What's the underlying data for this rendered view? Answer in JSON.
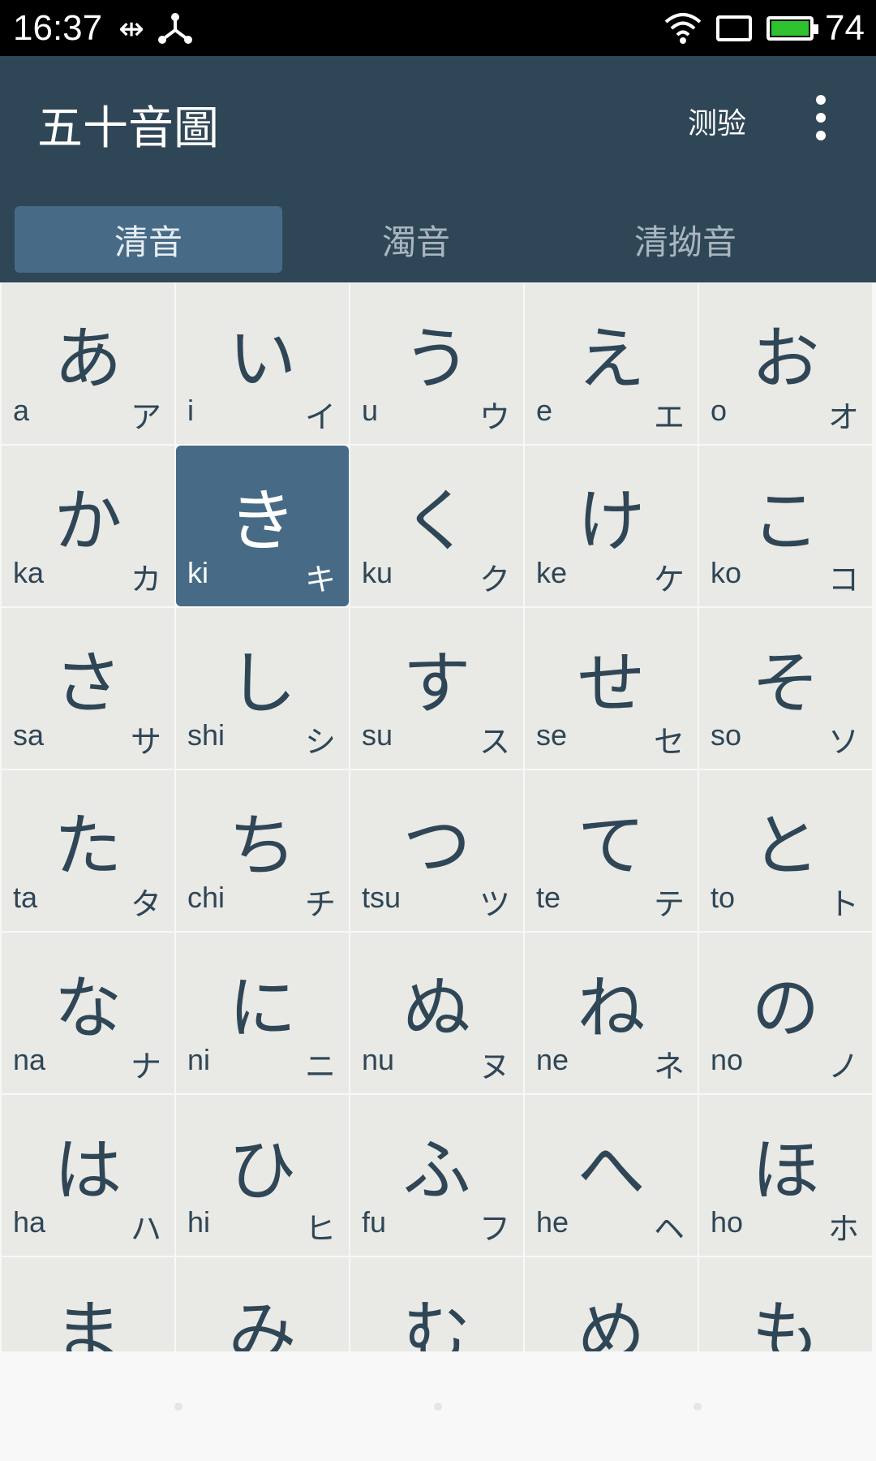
{
  "status_bar": {
    "time": "16:37",
    "battery_level": "74",
    "icons": [
      "usb-icon",
      "usb-network-icon",
      "wifi-icon",
      "rotation-icon",
      "battery-icon"
    ]
  },
  "app_bar": {
    "title": "五十音圖",
    "quiz_label": "测验",
    "more_icon": "more-vert-icon"
  },
  "tabs": [
    {
      "label": "清音",
      "active": true
    },
    {
      "label": "濁音",
      "active": false
    },
    {
      "label": "清拗音",
      "active": false
    }
  ],
  "grid": {
    "selected": "ki",
    "cells": [
      {
        "kana": "あ",
        "romaji": "a",
        "katakana": "ア"
      },
      {
        "kana": "い",
        "romaji": "i",
        "katakana": "イ"
      },
      {
        "kana": "う",
        "romaji": "u",
        "katakana": "ウ"
      },
      {
        "kana": "え",
        "romaji": "e",
        "katakana": "エ"
      },
      {
        "kana": "お",
        "romaji": "o",
        "katakana": "オ"
      },
      {
        "kana": "か",
        "romaji": "ka",
        "katakana": "カ"
      },
      {
        "kana": "き",
        "romaji": "ki",
        "katakana": "キ"
      },
      {
        "kana": "く",
        "romaji": "ku",
        "katakana": "ク"
      },
      {
        "kana": "け",
        "romaji": "ke",
        "katakana": "ケ"
      },
      {
        "kana": "こ",
        "romaji": "ko",
        "katakana": "コ"
      },
      {
        "kana": "さ",
        "romaji": "sa",
        "katakana": "サ"
      },
      {
        "kana": "し",
        "romaji": "shi",
        "katakana": "シ"
      },
      {
        "kana": "す",
        "romaji": "su",
        "katakana": "ス"
      },
      {
        "kana": "せ",
        "romaji": "se",
        "katakana": "セ"
      },
      {
        "kana": "そ",
        "romaji": "so",
        "katakana": "ソ"
      },
      {
        "kana": "た",
        "romaji": "ta",
        "katakana": "タ"
      },
      {
        "kana": "ち",
        "romaji": "chi",
        "katakana": "チ"
      },
      {
        "kana": "つ",
        "romaji": "tsu",
        "katakana": "ツ"
      },
      {
        "kana": "て",
        "romaji": "te",
        "katakana": "テ"
      },
      {
        "kana": "と",
        "romaji": "to",
        "katakana": "ト"
      },
      {
        "kana": "な",
        "romaji": "na",
        "katakana": "ナ"
      },
      {
        "kana": "に",
        "romaji": "ni",
        "katakana": "ニ"
      },
      {
        "kana": "ぬ",
        "romaji": "nu",
        "katakana": "ヌ"
      },
      {
        "kana": "ね",
        "romaji": "ne",
        "katakana": "ネ"
      },
      {
        "kana": "の",
        "romaji": "no",
        "katakana": "ノ"
      },
      {
        "kana": "は",
        "romaji": "ha",
        "katakana": "ハ"
      },
      {
        "kana": "ひ",
        "romaji": "hi",
        "katakana": "ヒ"
      },
      {
        "kana": "ふ",
        "romaji": "fu",
        "katakana": "フ"
      },
      {
        "kana": "へ",
        "romaji": "he",
        "katakana": "ヘ"
      },
      {
        "kana": "ほ",
        "romaji": "ho",
        "katakana": "ホ"
      },
      {
        "kana": "ま",
        "romaji": "",
        "katakana": ""
      },
      {
        "kana": "み",
        "romaji": "",
        "katakana": ""
      },
      {
        "kana": "む",
        "romaji": "",
        "katakana": ""
      },
      {
        "kana": "め",
        "romaji": "",
        "katakana": ""
      },
      {
        "kana": "も",
        "romaji": "",
        "katakana": ""
      }
    ]
  },
  "colors": {
    "app_bar": "#2f4656",
    "accent": "#476b86",
    "cell_bg": "#e9e9e5",
    "kana_text": "#2f4656"
  }
}
